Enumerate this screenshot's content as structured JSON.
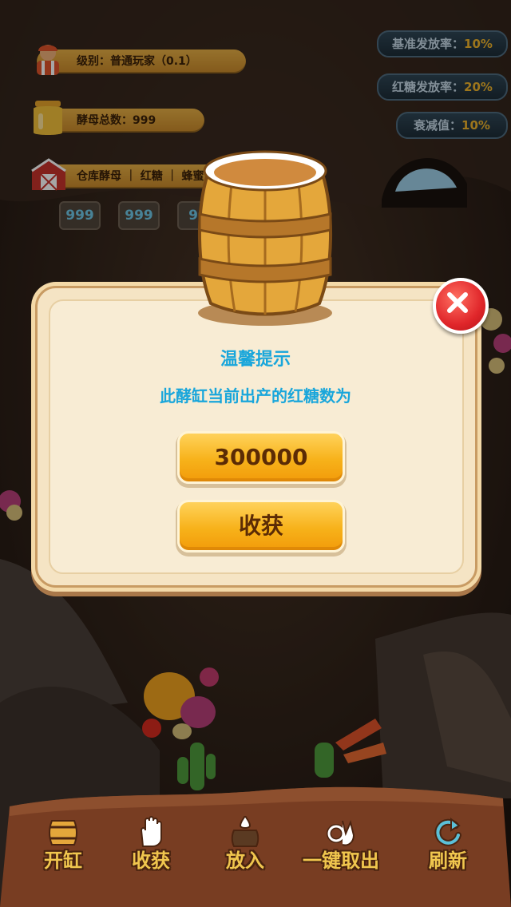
{
  "hud": {
    "level_text": "级别：普通玩家（0.1）",
    "yeast_total_text": "酵母总数：999",
    "warehouse_text": "仓库酵母 ｜ 红糖 ｜ 蜂蜜",
    "counts": [
      "999",
      "999",
      "99"
    ]
  },
  "rates": [
    {
      "label": "基准发放率：",
      "value": "10%"
    },
    {
      "label": "红糖发放率：",
      "value": "20%"
    },
    {
      "label": "衰减值：",
      "value": "10%"
    }
  ],
  "dialog": {
    "title": "温馨提示",
    "message": "此酵缸当前出产的红糖数为",
    "amount": "300000",
    "harvest_label": "收获"
  },
  "toolbar": [
    {
      "label": "开缸",
      "icon": "barrel-icon"
    },
    {
      "label": "收获",
      "icon": "hand-icon"
    },
    {
      "label": "放入",
      "icon": "drop-barrel-icon"
    },
    {
      "label": "一键取出",
      "icon": "ok-hand-icon"
    },
    {
      "label": "刷新",
      "icon": "refresh-icon"
    }
  ],
  "colors": {
    "accent_blue": "#19a6db",
    "gold": "#f7b21a",
    "close_red": "#e0262a"
  }
}
